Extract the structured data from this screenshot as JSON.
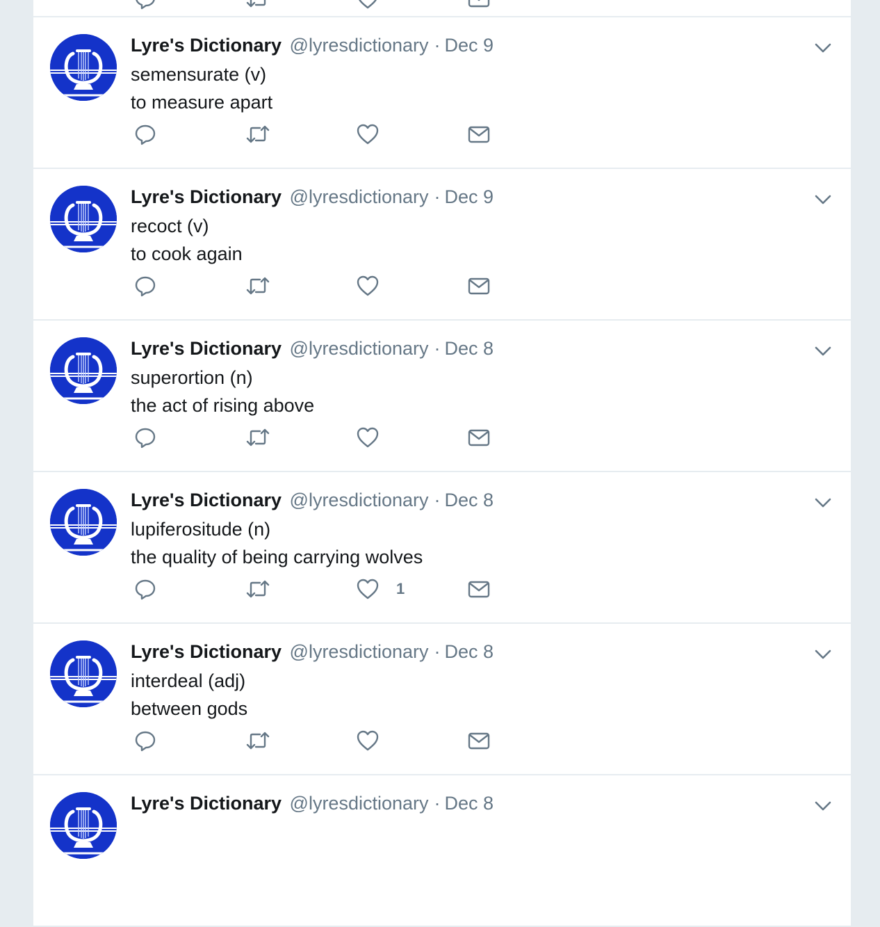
{
  "accent": "#1433c9",
  "icons": {
    "avatar": "lyre-logo",
    "caret": "chevron-down-icon",
    "reply": "reply-icon",
    "retweet": "retweet-icon",
    "like": "heart-icon",
    "dm": "envelope-icon"
  },
  "tweets": [
    {
      "name": "Lyre's Dictionary",
      "handle": "@lyresdictionary",
      "sep": "·",
      "date": "Dec 9",
      "word": "semensurate (v)",
      "definition": "to measure apart",
      "likes": ""
    },
    {
      "name": "Lyre's Dictionary",
      "handle": "@lyresdictionary",
      "sep": "·",
      "date": "Dec 9",
      "word": "recoct (v)",
      "definition": "to cook again",
      "likes": ""
    },
    {
      "name": "Lyre's Dictionary",
      "handle": "@lyresdictionary",
      "sep": "·",
      "date": "Dec 8",
      "word": "superortion (n)",
      "definition": "the act of rising above",
      "likes": ""
    },
    {
      "name": "Lyre's Dictionary",
      "handle": "@lyresdictionary",
      "sep": "·",
      "date": "Dec 8",
      "word": "lupiferositude (n)",
      "definition": "the quality of being carrying wolves",
      "likes": "1"
    },
    {
      "name": "Lyre's Dictionary",
      "handle": "@lyresdictionary",
      "sep": "·",
      "date": "Dec 8",
      "word": "interdeal (adj)",
      "definition": "between gods",
      "likes": ""
    },
    {
      "name": "Lyre's Dictionary",
      "handle": "@lyresdictionary",
      "sep": "·",
      "date": "Dec 8",
      "word": "",
      "definition": "",
      "likes": ""
    }
  ]
}
